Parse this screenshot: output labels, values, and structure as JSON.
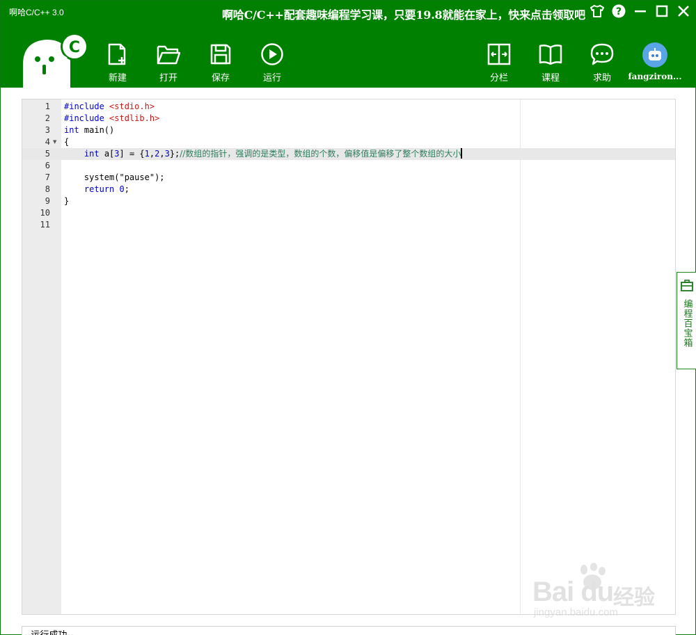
{
  "window": {
    "title": "啊哈C/C++ 3.0",
    "promo_text": "啊哈C/C++配套趣味编程学习课，只要19.8就能在家上，快来点击领取吧"
  },
  "window_controls": [
    "skin-icon",
    "help-icon",
    "minimize-icon",
    "maximize-icon",
    "close-icon"
  ],
  "toolbar": {
    "new_label": "新建",
    "open_label": "打开",
    "save_label": "保存",
    "run_label": "运行",
    "split_label": "分栏",
    "course_label": "课程",
    "help_label": "求助"
  },
  "user": {
    "name": "fangziron..."
  },
  "editor": {
    "line_numbers": [
      "1",
      "2",
      "3",
      "4",
      "5",
      "6",
      "7",
      "8",
      "9",
      "10",
      "11"
    ],
    "lines": [
      [
        {
          "t": "#include ",
          "c": "kw"
        },
        {
          "t": "<stdio.h>",
          "c": "str"
        }
      ],
      [
        {
          "t": "#include ",
          "c": "kw"
        },
        {
          "t": "<stdlib.h>",
          "c": "str"
        }
      ],
      [
        {
          "t": "int",
          "c": "kw"
        },
        {
          "t": " main()",
          "c": ""
        }
      ],
      [
        {
          "t": "{",
          "c": ""
        }
      ],
      [
        {
          "t": "    ",
          "c": ""
        },
        {
          "t": "int",
          "c": "kw"
        },
        {
          "t": " a[",
          "c": ""
        },
        {
          "t": "3",
          "c": "num"
        },
        {
          "t": "] = {",
          "c": ""
        },
        {
          "t": "1",
          "c": "num"
        },
        {
          "t": ",",
          "c": ""
        },
        {
          "t": "2",
          "c": "num"
        },
        {
          "t": ",",
          "c": ""
        },
        {
          "t": "3",
          "c": "num"
        },
        {
          "t": "};",
          "c": ""
        },
        {
          "t": "//数组的指针，强调的是类型，数组的个数，偏移值是偏移了整个数组的大小",
          "c": "cmt"
        }
      ],
      [],
      [
        {
          "t": "    system(",
          "c": ""
        },
        {
          "t": "\"pause\"",
          "c": ""
        },
        {
          "t": ");",
          "c": ""
        }
      ],
      [
        {
          "t": "    ",
          "c": ""
        },
        {
          "t": "return",
          "c": "kw"
        },
        {
          "t": " ",
          "c": ""
        },
        {
          "t": "0",
          "c": "num"
        },
        {
          "t": ";",
          "c": ""
        }
      ],
      [
        {
          "t": "}",
          "c": ""
        }
      ],
      [],
      []
    ],
    "active_line": 5,
    "fold_line": 4
  },
  "side_panel": {
    "label": "编程百宝箱"
  },
  "output": {
    "text": "--运行成功--"
  },
  "watermark": {
    "brand": "Bai du",
    "brand_cn": "经验",
    "url": "jingyan.baidu.com"
  },
  "colors": {
    "header_bg": "#008000",
    "keyword": "#0000cc",
    "string": "#c41a16",
    "comment": "#2e7d5b"
  }
}
